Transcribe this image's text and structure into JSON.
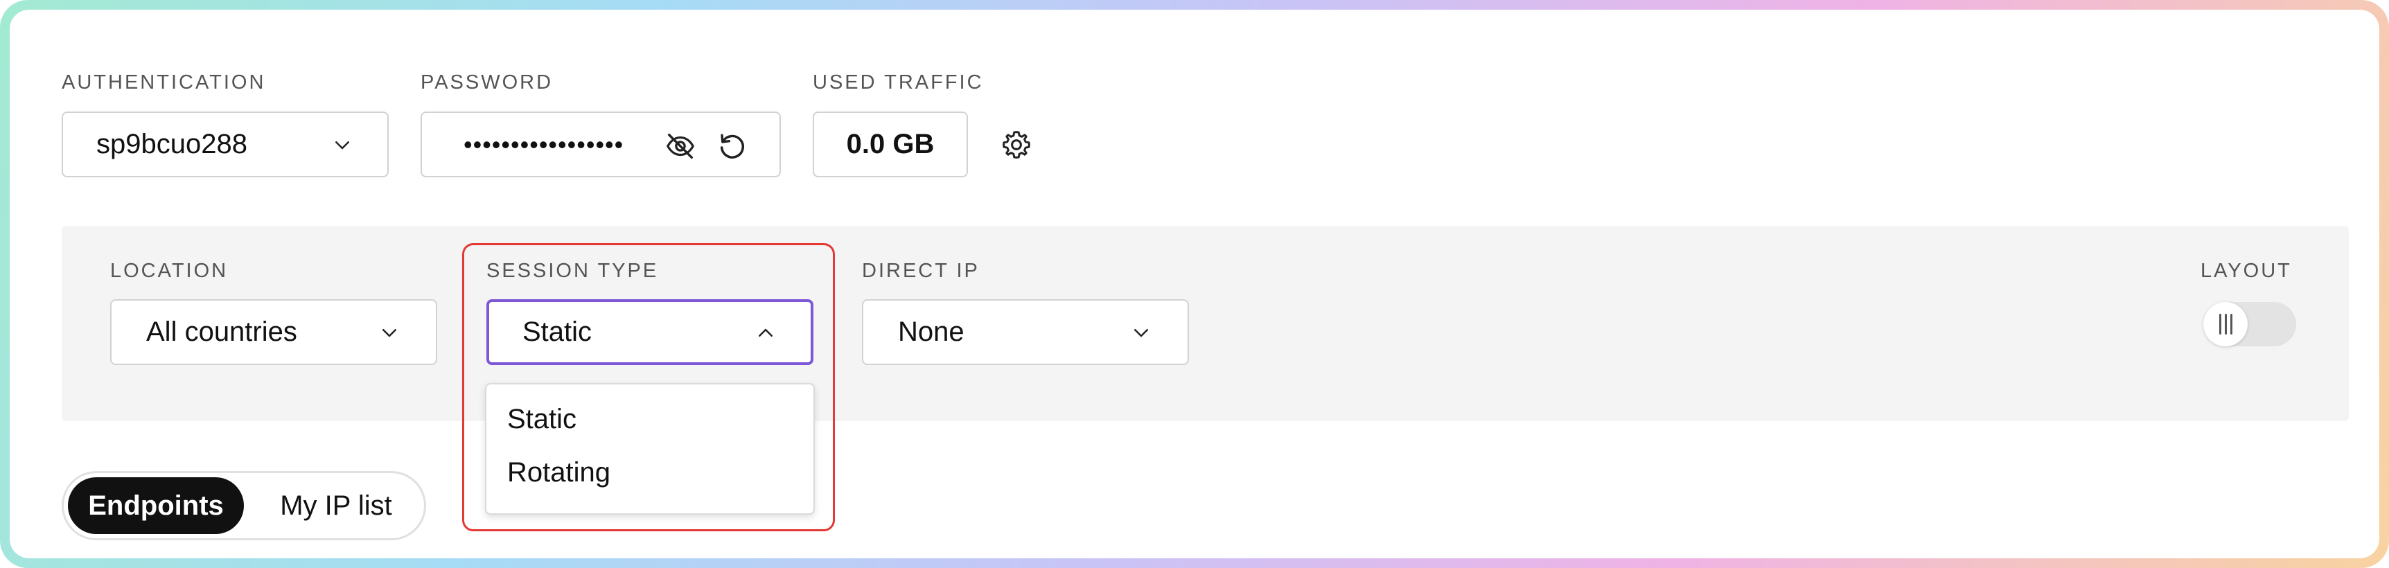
{
  "top": {
    "authentication": {
      "label": "AUTHENTICATION",
      "value": "sp9bcuo288"
    },
    "password": {
      "label": "PASSWORD",
      "masked_value": "•••••••••••••••••"
    },
    "used_traffic": {
      "label": "USED TRAFFIC",
      "value": "0.0 GB"
    }
  },
  "filters": {
    "location": {
      "label": "LOCATION",
      "value": "All countries"
    },
    "session_type": {
      "label": "SESSION TYPE",
      "value": "Static",
      "expanded": true,
      "options": [
        "Static",
        "Rotating"
      ]
    },
    "direct_ip": {
      "label": "DIRECT IP",
      "value": "None"
    },
    "layout": {
      "label": "LAYOUT"
    }
  },
  "tabs": [
    {
      "label": "Endpoints",
      "active": true
    },
    {
      "label": "My IP list",
      "active": false
    }
  ],
  "colors": {
    "session_focus": "#7e57d6",
    "highlight_outline": "#e53935",
    "active_tab_bg": "#111111",
    "panel_bg": "#f4f4f4"
  }
}
